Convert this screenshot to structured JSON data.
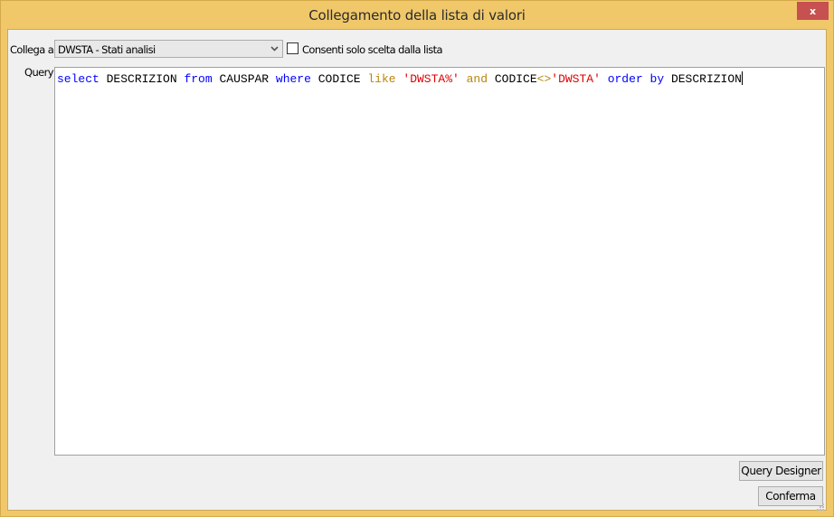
{
  "window": {
    "title": "Collegamento della lista di valori",
    "close_label": "x",
    "accent_color": "#f0c86a",
    "close_color": "#c75050"
  },
  "collega": {
    "label": "Collega a",
    "selected_value": "DWSTA - Stati analisi",
    "arrow_icon": "chevron-down-icon"
  },
  "checkbox": {
    "label": "Consenti solo scelta dalla lista",
    "checked": false
  },
  "query": {
    "label": "Query",
    "tokens": [
      {
        "text": "select",
        "type": "kw"
      },
      {
        "text": " ",
        "type": "id"
      },
      {
        "text": "DESCRIZION",
        "type": "id"
      },
      {
        "text": " ",
        "type": "id"
      },
      {
        "text": "from",
        "type": "kw"
      },
      {
        "text": " ",
        "type": "id"
      },
      {
        "text": "CAUSPAR",
        "type": "id"
      },
      {
        "text": " ",
        "type": "id"
      },
      {
        "text": "where",
        "type": "kw"
      },
      {
        "text": " ",
        "type": "id"
      },
      {
        "text": "CODICE",
        "type": "id"
      },
      {
        "text": " ",
        "type": "id"
      },
      {
        "text": "like",
        "type": "op"
      },
      {
        "text": " ",
        "type": "id"
      },
      {
        "text": "'DWSTA%'",
        "type": "str"
      },
      {
        "text": " ",
        "type": "id"
      },
      {
        "text": "and",
        "type": "op"
      },
      {
        "text": " ",
        "type": "id"
      },
      {
        "text": "CODICE",
        "type": "id"
      },
      {
        "text": "<>",
        "type": "op"
      },
      {
        "text": "'DWSTA'",
        "type": "str"
      },
      {
        "text": " ",
        "type": "id"
      },
      {
        "text": "order",
        "type": "kw"
      },
      {
        "text": " ",
        "type": "id"
      },
      {
        "text": "by",
        "type": "kw"
      },
      {
        "text": " ",
        "type": "id"
      },
      {
        "text": "DESCRIZION",
        "type": "id"
      }
    ]
  },
  "buttons": {
    "query_designer": "Query Designer",
    "confirm": "Conferma"
  }
}
